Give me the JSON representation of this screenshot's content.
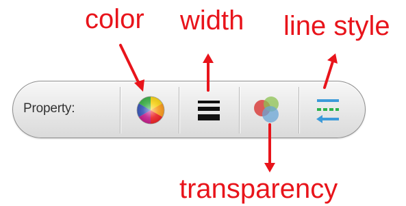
{
  "annotations": {
    "color": "color",
    "width": "width",
    "line_style": "line style",
    "transparency": "transparency",
    "annotation_color": "#e8141b"
  },
  "toolbar": {
    "label": "Property:",
    "buttons": [
      {
        "name": "color",
        "icon": "color-wheel-icon"
      },
      {
        "name": "width",
        "icon": "line-width-icon"
      },
      {
        "name": "transparency",
        "icon": "transparency-icon"
      },
      {
        "name": "line style",
        "icon": "line-style-icon"
      }
    ]
  }
}
